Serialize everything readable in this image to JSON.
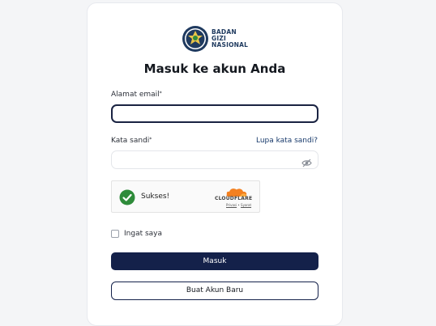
{
  "brand": {
    "line1": "BADAN",
    "line2": "GIZI",
    "line3": "NASIONAL"
  },
  "title": "Masuk ke akun Anda",
  "email": {
    "label": "Alamat email",
    "required_mark": "*",
    "value": "",
    "placeholder": ""
  },
  "password": {
    "label": "Kata sandi",
    "required_mark": "*",
    "forgot_link": "Lupa kata sandi?",
    "value": "",
    "placeholder": ""
  },
  "captcha": {
    "status": "Sukses!",
    "provider": "CLOUDFLARE",
    "privacy": "Privasi",
    "separator": " • ",
    "terms": "Syarat"
  },
  "remember": {
    "label": "Ingat saya",
    "checked": false
  },
  "buttons": {
    "login": "Masuk",
    "register": "Buat Akun Baru"
  },
  "colors": {
    "primary": "#14214a",
    "link": "#183a6b",
    "success": "#2e8b3a",
    "cloudflare_orange": "#f38020"
  }
}
